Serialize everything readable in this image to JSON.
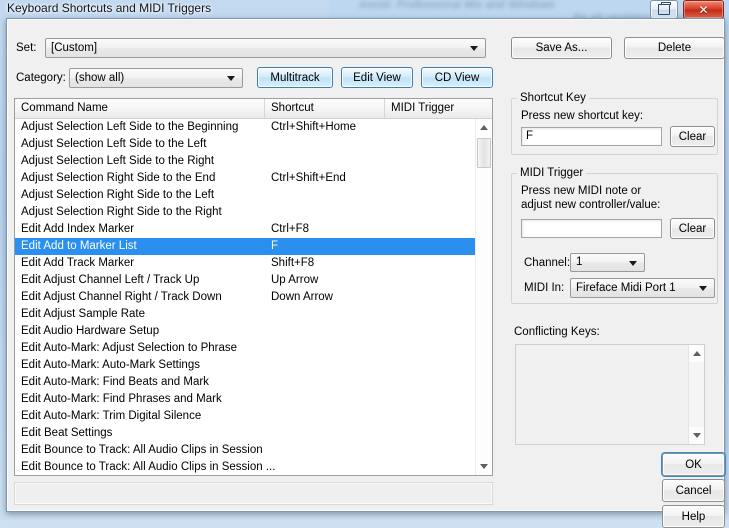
{
  "window": {
    "title": "Keyboard Shortcuts and MIDI Triggers",
    "restore_label": "❐",
    "close_label": "✕"
  },
  "background": {
    "line1": "Assist: Professional Mix and Windows",
    "line2": "for all versions of list your la"
  },
  "top": {
    "set_label": "Set:",
    "set_value": "[Custom]",
    "category_label": "Category:",
    "category_value": "(show all)",
    "multitrack_label": "Multitrack",
    "edit_view_label": "Edit View",
    "cd_view_label": "CD View"
  },
  "right": {
    "save_as_label": "Save As...",
    "delete_label": "Delete",
    "shortcut_group_title": "Shortcut Key",
    "shortcut_prompt": "Press new shortcut key:",
    "shortcut_value": "F",
    "shortcut_clear_label": "Clear",
    "midi_group_title": "MIDI Trigger",
    "midi_prompt_line1": "Press new MIDI note or",
    "midi_prompt_line2": "adjust new controller/value:",
    "midi_value": "",
    "midi_clear_label": "Clear",
    "channel_label": "Channel:",
    "channel_value": "1",
    "midi_in_label": "MIDI In:",
    "midi_in_value": "Fireface Midi Port 1",
    "conflicting_label": "Conflicting Keys:",
    "ok_label": "OK",
    "cancel_label": "Cancel",
    "help_label": "Help"
  },
  "list": {
    "columns": [
      "Command Name",
      "Shortcut",
      "MIDI Trigger"
    ],
    "selected_index": 7,
    "rows": [
      {
        "command": "Adjust Selection Left Side to the Beginning",
        "shortcut": "Ctrl+Shift+Home",
        "midi": ""
      },
      {
        "command": "Adjust Selection Left Side to the Left",
        "shortcut": "",
        "midi": ""
      },
      {
        "command": "Adjust Selection Left Side to the Right",
        "shortcut": "",
        "midi": ""
      },
      {
        "command": "Adjust Selection Right Side to the End",
        "shortcut": "Ctrl+Shift+End",
        "midi": ""
      },
      {
        "command": "Adjust Selection Right Side to the Left",
        "shortcut": "",
        "midi": ""
      },
      {
        "command": "Adjust Selection Right Side to the Right",
        "shortcut": "",
        "midi": ""
      },
      {
        "command": "Edit Add Index Marker",
        "shortcut": "Ctrl+F8",
        "midi": ""
      },
      {
        "command": "Edit Add to Marker List",
        "shortcut": "F",
        "midi": ""
      },
      {
        "command": "Edit Add Track Marker",
        "shortcut": "Shift+F8",
        "midi": ""
      },
      {
        "command": "Edit Adjust Channel Left / Track Up",
        "shortcut": "Up Arrow",
        "midi": ""
      },
      {
        "command": "Edit Adjust Channel Right / Track Down",
        "shortcut": "Down Arrow",
        "midi": ""
      },
      {
        "command": "Edit Adjust Sample Rate",
        "shortcut": "",
        "midi": ""
      },
      {
        "command": "Edit Audio Hardware Setup",
        "shortcut": "",
        "midi": ""
      },
      {
        "command": "Edit Auto-Mark: Adjust Selection to Phrase",
        "shortcut": "",
        "midi": ""
      },
      {
        "command": "Edit Auto-Mark: Auto-Mark Settings",
        "shortcut": "",
        "midi": ""
      },
      {
        "command": "Edit Auto-Mark: Find Beats and Mark",
        "shortcut": "",
        "midi": ""
      },
      {
        "command": "Edit Auto-Mark: Find Phrases and Mark",
        "shortcut": "",
        "midi": ""
      },
      {
        "command": "Edit Auto-Mark: Trim Digital Silence",
        "shortcut": "",
        "midi": ""
      },
      {
        "command": "Edit Beat Settings",
        "shortcut": "",
        "midi": ""
      },
      {
        "command": "Edit Bounce to Track: All Audio Clips in Session",
        "shortcut": "",
        "midi": ""
      },
      {
        "command": "Edit Bounce to Track: All Audio Clips in Session ...",
        "shortcut": "",
        "midi": ""
      }
    ]
  },
  "colors": {
    "selection": "#2a8fef",
    "dialog_bg": "#f0f0f0",
    "accent_button": "#bfe2f7"
  }
}
